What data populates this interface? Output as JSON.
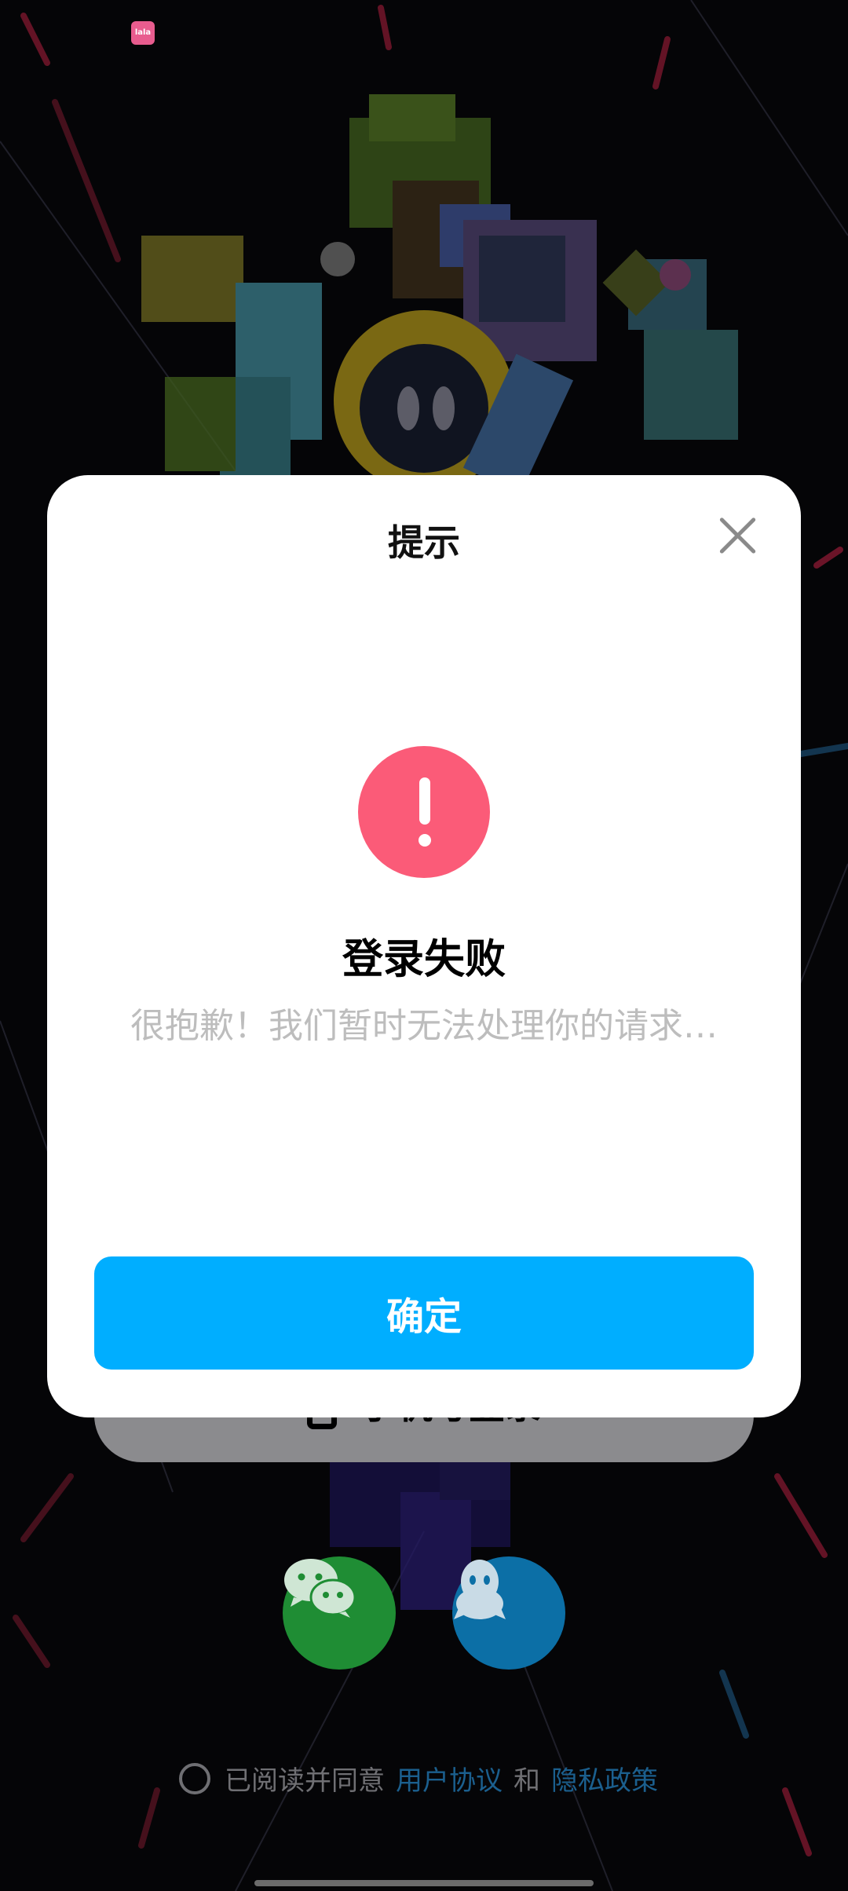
{
  "background": {
    "app_icon_text": "lala"
  },
  "login": {
    "phone_login_label": "手机号登录",
    "wechat_icon": "wechat-icon",
    "qq_icon": "qq-icon"
  },
  "agreement": {
    "prefix": "已阅读并同意",
    "user_agreement": "用户协议",
    "and": "和",
    "privacy_policy": "隐私政策"
  },
  "dialog": {
    "title": "提示",
    "close_icon": "close-icon",
    "alert_icon": "exclamation-icon",
    "heading": "登录失败",
    "message": "很抱歉！我们暂时无法处理你的请求…",
    "confirm_label": "确定"
  },
  "colors": {
    "accent": "#00aeff",
    "alert": "#fb5b78",
    "link": "#1b5f8e"
  }
}
